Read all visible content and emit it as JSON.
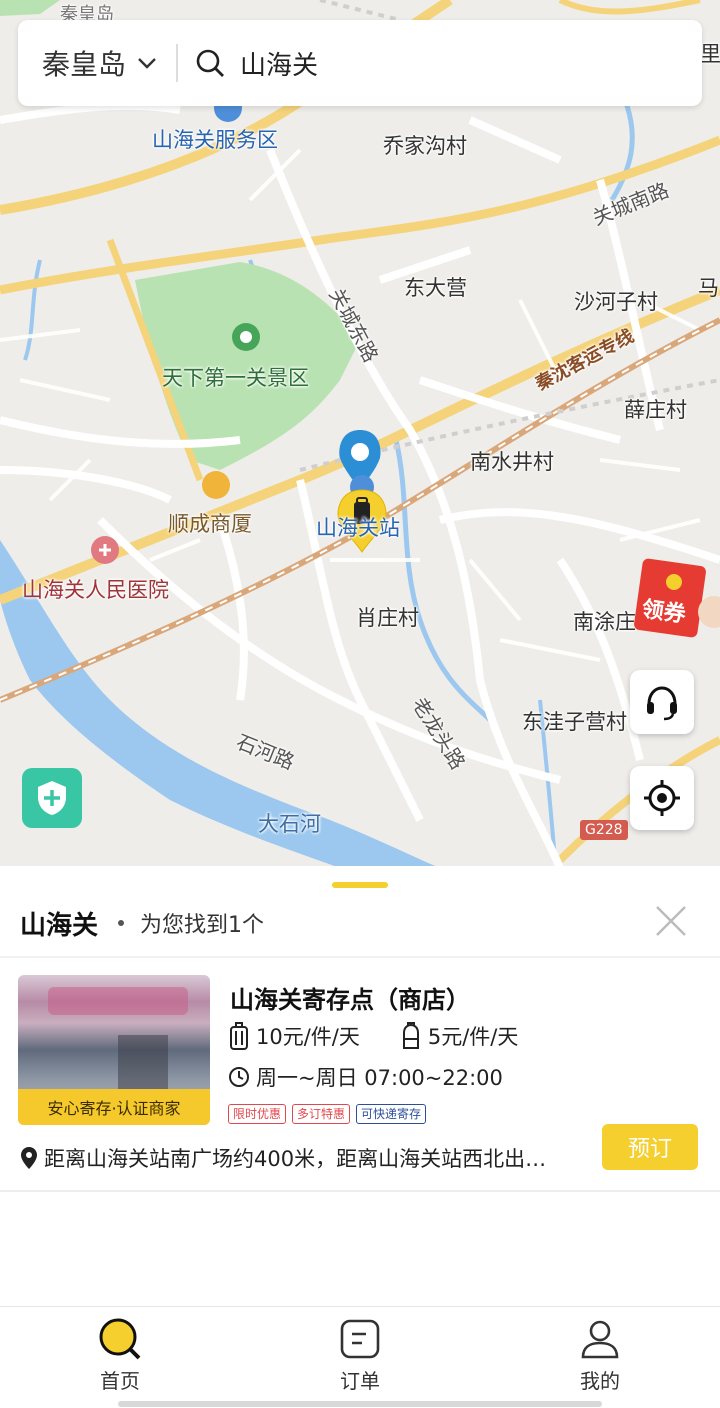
{
  "search": {
    "city": "秦皇岛",
    "query": "山海关"
  },
  "map": {
    "labels": {
      "top_cut": "秦皇岛",
      "service_area": "山海关服务区",
      "qiaojiagou": "乔家沟村",
      "guancheng_south_rd": "关城南路",
      "mazhuang": "马",
      "dongdaying": "东大营",
      "guancheng_east_rd": "关城东路",
      "shahezi": "沙河子村",
      "scenic": "天下第一关景区",
      "rail_line": "秦沈客运专线",
      "xuezhuang": "薛庄村",
      "nanshuijing": "南水井村",
      "shuncheng": "顺成商厦",
      "station": "山海关站",
      "hospital": "山海关人民医院",
      "nantu": "南涂庄",
      "xiaozhuang": "肖庄村",
      "laolongtou_rd": "老龙头路",
      "dongwazi": "东洼子营村",
      "shihe_rd": "石河路",
      "dashihe": "大石河",
      "g228": "G228",
      "right_cut": "里"
    },
    "coupon_label": "领券"
  },
  "sheet": {
    "title": "山海关",
    "result_text": "为您找到1个"
  },
  "result": {
    "name": "山海关寄存点（商店）",
    "thumb_badge": "安心寄存·认证商家",
    "price_luggage": "10元/件/天",
    "price_backpack": "5元/件/天",
    "hours": "周一~周日 07:00~22:00",
    "tags": [
      "限时优惠",
      "多订特惠",
      "可快递寄存"
    ],
    "address": "距离山海关站南广场约400米，距离山海关站西北出…",
    "book_label": "预订"
  },
  "tabs": [
    {
      "label": "首页",
      "icon": "search-icon",
      "active": true
    },
    {
      "label": "订单",
      "icon": "orders-icon",
      "active": false
    },
    {
      "label": "我的",
      "icon": "profile-icon",
      "active": false
    }
  ],
  "colors": {
    "accent": "#f4cf2d",
    "map_bg": "#eeede9",
    "water": "#9cc8ef",
    "park": "#b9e2b2",
    "shield": "#39c6a5"
  }
}
